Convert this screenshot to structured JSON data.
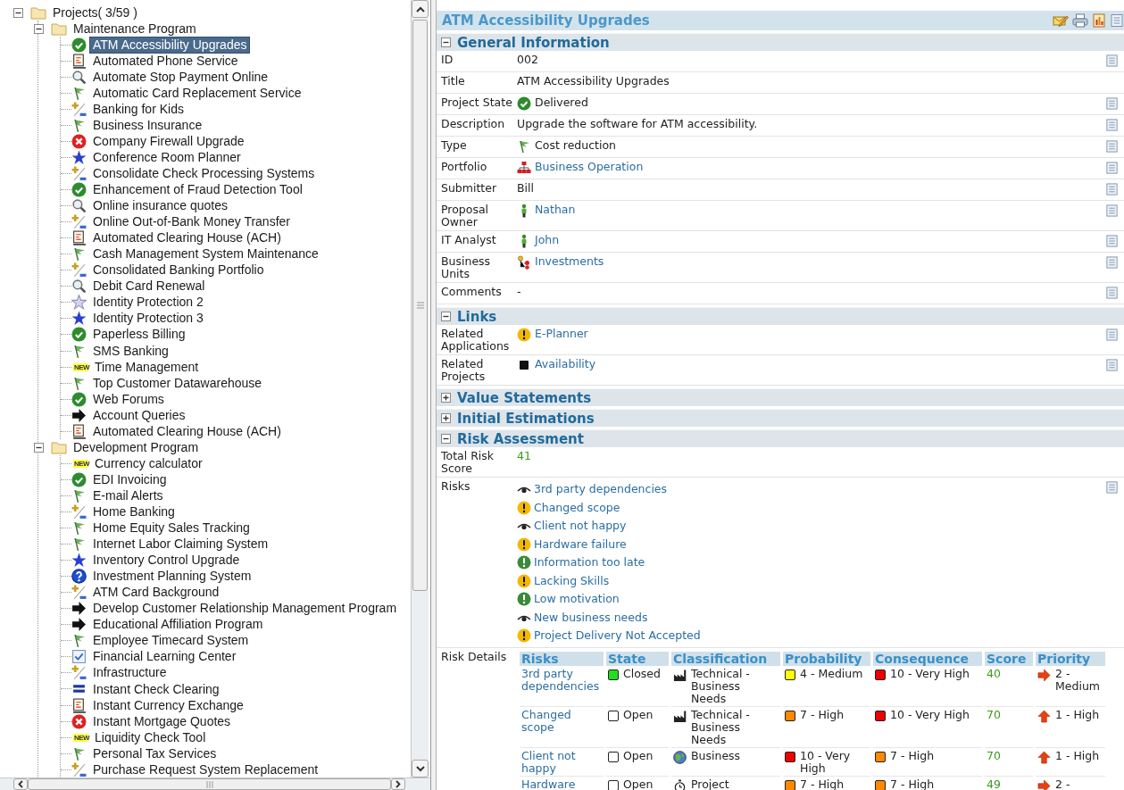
{
  "tree": {
    "label": "Projects( 3/59 )",
    "expanded": true,
    "children": [
      {
        "label": "Maintenance Program",
        "expanded": true,
        "children": [
          {
            "label": "ATM Accessibility Upgrades",
            "kind": "check",
            "selected": true
          },
          {
            "label": "Automated Phone Service",
            "kind": "doc",
            "selected": false
          },
          {
            "label": "Automate Stop Payment Online",
            "kind": "magnifier",
            "selected": false
          },
          {
            "label": "Automatic Card Replacement Service",
            "kind": "flag",
            "selected": false
          },
          {
            "label": "Banking for Kids",
            "kind": "plusminus",
            "selected": false
          },
          {
            "label": "Business Insurance",
            "kind": "flag",
            "selected": false
          },
          {
            "label": "Company Firewall Upgrade",
            "kind": "error",
            "selected": false
          },
          {
            "label": "Conference Room Planner",
            "kind": "star",
            "selected": false
          },
          {
            "label": "Consolidate Check Processing Systems",
            "kind": "plusminus",
            "selected": false
          },
          {
            "label": "Enhancement of Fraud Detection Tool",
            "kind": "check",
            "selected": false
          },
          {
            "label": "Online insurance quotes",
            "kind": "magnifier",
            "selected": false
          },
          {
            "label": "Online Out-of-Bank Money Transfer",
            "kind": "plusminus",
            "selected": false
          },
          {
            "label": "Automated Clearing House (ACH)",
            "kind": "doc",
            "selected": false
          },
          {
            "label": "Cash Management System Maintenance",
            "kind": "flag",
            "selected": false
          },
          {
            "label": "Consolidated Banking Portfolio",
            "kind": "plusminus",
            "selected": false
          },
          {
            "label": "Debit Card Renewal",
            "kind": "magnifier",
            "selected": false
          },
          {
            "label": "Identity Protection 2",
            "kind": "star_outline",
            "selected": false
          },
          {
            "label": "Identity Protection 3",
            "kind": "star",
            "selected": false
          },
          {
            "label": "Paperless Billing",
            "kind": "check",
            "selected": false
          },
          {
            "label": "SMS Banking",
            "kind": "flag",
            "selected": false
          },
          {
            "label": "Time Management",
            "kind": "new",
            "badge": "NEW",
            "selected": false
          },
          {
            "label": "Top Customer Datawarehouse",
            "kind": "flag",
            "selected": false
          },
          {
            "label": "Web Forums",
            "kind": "check",
            "selected": false
          },
          {
            "label": "Account Queries",
            "kind": "arrow",
            "selected": false
          },
          {
            "label": "Automated Clearing House (ACH)",
            "kind": "doc",
            "selected": false
          }
        ]
      },
      {
        "label": "Development Program",
        "expanded": true,
        "children": [
          {
            "label": "Currency calculator",
            "kind": "new",
            "badge": "NEW",
            "selected": false
          },
          {
            "label": "EDI Invoicing",
            "kind": "check",
            "selected": false
          },
          {
            "label": "E-mail Alerts",
            "kind": "flag",
            "selected": false
          },
          {
            "label": "Home Banking",
            "kind": "plusminus",
            "selected": false
          },
          {
            "label": "Home Equity Sales Tracking",
            "kind": "flag",
            "selected": false
          },
          {
            "label": "Internet Labor Claiming System",
            "kind": "flag",
            "selected": false
          },
          {
            "label": "Inventory Control Upgrade",
            "kind": "star",
            "selected": false
          },
          {
            "label": "Investment Planning System",
            "kind": "help",
            "selected": false
          },
          {
            "label": "ATM Card Background",
            "kind": "plusminus",
            "selected": false
          },
          {
            "label": "Develop Customer Relationship Management Program",
            "kind": "arrow",
            "selected": false
          },
          {
            "label": "Educational Affiliation Program",
            "kind": "arrow",
            "selected": false
          },
          {
            "label": "Employee Timecard System",
            "kind": "flag",
            "selected": false
          },
          {
            "label": "Financial Learning Center",
            "kind": "checkbox",
            "selected": false
          },
          {
            "label": "Infrastructure",
            "kind": "plusminus",
            "selected": false
          },
          {
            "label": "Instant Check Clearing",
            "kind": "equals",
            "selected": false
          },
          {
            "label": "Instant Currency Exchange",
            "kind": "doc",
            "selected": false
          },
          {
            "label": "Instant Mortgage Quotes",
            "kind": "error",
            "selected": false
          },
          {
            "label": "Liquidity Check Tool",
            "kind": "new",
            "badge": "NEW",
            "selected": false
          },
          {
            "label": "Personal Tax Services",
            "kind": "flag",
            "selected": false
          },
          {
            "label": "Purchase Request System Replacement",
            "kind": "plusminus",
            "selected": false
          }
        ]
      }
    ]
  },
  "detail": {
    "title": "ATM Accessibility Upgrades",
    "sections": [
      {
        "title": "General Information",
        "expanded": true,
        "fields": [
          {
            "label": "ID",
            "value": "002",
            "link": false,
            "note": true
          },
          {
            "label": "Title",
            "value": "ATM Accessibility Upgrades",
            "link": false,
            "note": false
          },
          {
            "label": "Project State",
            "value": "Delivered",
            "kind": "check",
            "link": false,
            "note": true
          },
          {
            "label": "Description",
            "value": "Upgrade the software for ATM accessibility.",
            "link": false,
            "note": true
          },
          {
            "label": "Type",
            "value": "Cost reduction",
            "kind": "flag",
            "link": false,
            "note": true
          },
          {
            "label": "Portfolio",
            "value": "Business Operation",
            "kind": "org",
            "link": true,
            "note": true
          },
          {
            "label": "Submitter",
            "value": "Bill",
            "link": false,
            "note": true
          },
          {
            "label": "Proposal Owner",
            "value": "Nathan",
            "kind": "person",
            "link": true,
            "note": true
          },
          {
            "label": "IT Analyst",
            "value": "John",
            "kind": "person",
            "link": true,
            "note": true
          },
          {
            "label": "Business Units",
            "value": "Investments",
            "kind": "units",
            "link": true,
            "note": true
          },
          {
            "label": "Comments",
            "value": "-",
            "link": false,
            "note": true
          }
        ]
      },
      {
        "title": "Links",
        "expanded": true,
        "fields": [
          {
            "label": "Related Applications",
            "value": "E-Planner",
            "kind": "warning",
            "link": true,
            "note": true
          },
          {
            "label": "Related Projects",
            "value": "Availability",
            "kind": "square",
            "link": true,
            "note": true
          }
        ]
      },
      {
        "title": "Value Statements",
        "expanded": false
      },
      {
        "title": "Initial Estimations",
        "expanded": false
      },
      {
        "title": "Risk Assessment",
        "expanded": true,
        "fields": [
          {
            "label": "Total Risk Score",
            "value": "41",
            "kind": "score",
            "link": false,
            "note": false
          },
          {
            "label": "Risks",
            "note": true,
            "items": [
              {
                "label": "3rd party dependencies",
                "kind": "eye"
              },
              {
                "label": "Changed scope",
                "kind": "warning"
              },
              {
                "label": "Client not happy",
                "kind": "eye"
              },
              {
                "label": "Hardware failure",
                "kind": "warning"
              },
              {
                "label": "Information too late",
                "kind": "notice"
              },
              {
                "label": "Lacking Skills",
                "kind": "warning"
              },
              {
                "label": "Low motivation",
                "kind": "notice"
              },
              {
                "label": "New business needs",
                "kind": "eye"
              },
              {
                "label": "Project Delivery Not Accepted",
                "kind": "warning"
              }
            ]
          },
          {
            "label": "Risk Details",
            "note": false,
            "table": {
              "columns": [
                "Risks",
                "State",
                "Classification",
                "Probability",
                "Consequence",
                "Score",
                "Priority"
              ],
              "rows": [
                {
                  "risk": "3rd party dependencies",
                  "state": {
                    "text": "Closed",
                    "color": "#22dd22"
                  },
                  "classification": {
                    "kind": "factory",
                    "text": "Technical - Business Needs"
                  },
                  "probability": {
                    "text": "4 - Medium",
                    "color": "#ffff00"
                  },
                  "consequence": {
                    "text": "10 - Very High",
                    "color": "#ee0000"
                  },
                  "score": "40",
                  "priority": {
                    "kind": "right",
                    "text": "2 - Medium"
                  }
                },
                {
                  "risk": "Changed scope",
                  "state": {
                    "text": "Open",
                    "color": "#ffffff"
                  },
                  "classification": {
                    "kind": "factory",
                    "text": "Technical - Business Needs"
                  },
                  "probability": {
                    "text": "7 - High",
                    "color": "#ff8800"
                  },
                  "consequence": {
                    "text": "10 - Very High",
                    "color": "#ee0000"
                  },
                  "score": "70",
                  "priority": {
                    "kind": "up",
                    "text": "1 - High"
                  }
                },
                {
                  "risk": "Client not happy",
                  "state": {
                    "text": "Open",
                    "color": "#ffffff"
                  },
                  "classification": {
                    "kind": "globe",
                    "text": "Business"
                  },
                  "probability": {
                    "text": "10 - Very High",
                    "color": "#ee0000"
                  },
                  "consequence": {
                    "text": "7 - High",
                    "color": "#ff8800"
                  },
                  "score": "70",
                  "priority": {
                    "kind": "up",
                    "text": "1 - High"
                  }
                },
                {
                  "risk": "Hardware",
                  "state": {
                    "text": "Open",
                    "color": "#ffffff"
                  },
                  "classification": {
                    "kind": "stopwatch",
                    "text": "Project"
                  },
                  "probability": {
                    "text": "7 - High",
                    "color": "#ff8800"
                  },
                  "consequence": {
                    "text": "7 - High",
                    "color": "#ff8800"
                  },
                  "score": "49",
                  "priority": {
                    "kind": "right",
                    "text": "2 -"
                  }
                }
              ]
            }
          }
        ]
      }
    ]
  }
}
